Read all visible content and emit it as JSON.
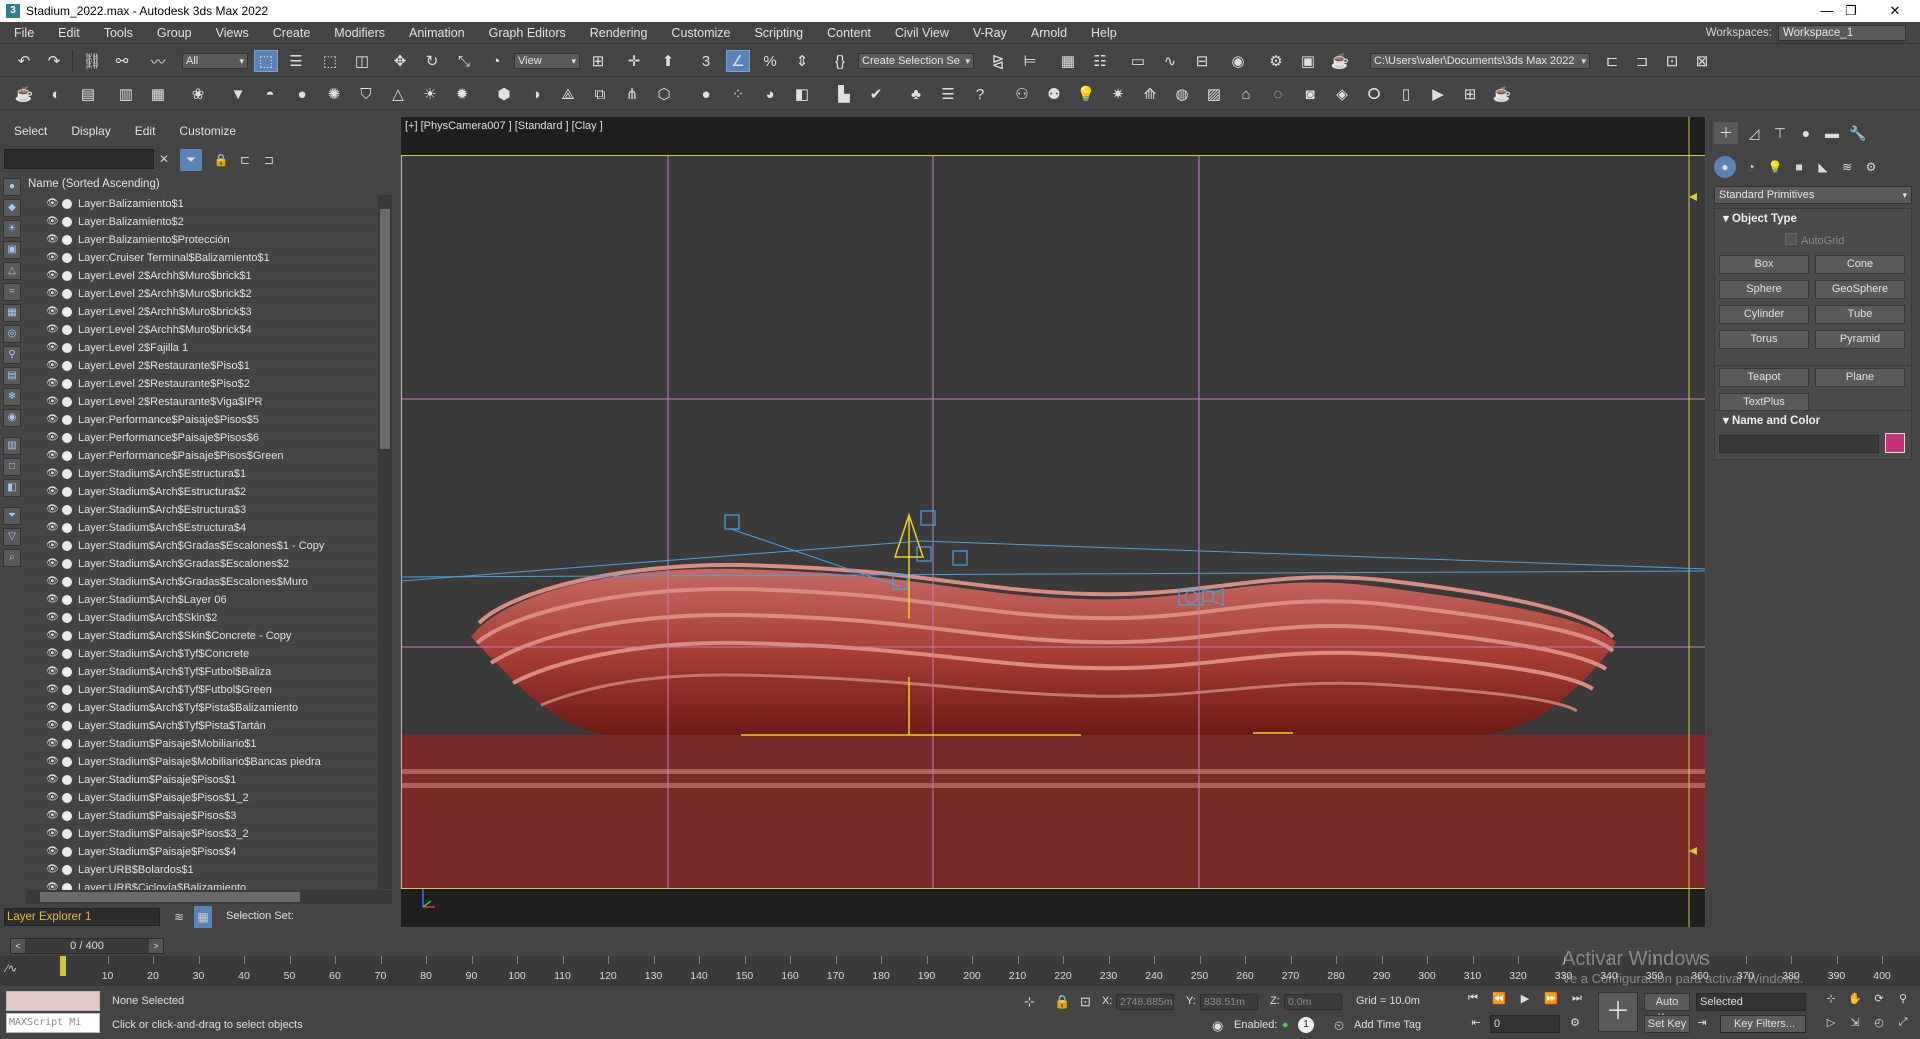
{
  "titlebar": {
    "title": "Stadium_2022.max - Autodesk 3ds Max 2022",
    "minimize": "—",
    "restore": "❐",
    "close": "✕"
  },
  "menu": {
    "items": [
      "File",
      "Edit",
      "Tools",
      "Group",
      "Views",
      "Create",
      "Modifiers",
      "Animation",
      "Graph Editors",
      "Rendering",
      "Customize",
      "Scripting",
      "Content",
      "Civil View",
      "V-Ray",
      "Arnold",
      "Help"
    ],
    "workspaces_label": "Workspaces:",
    "workspace_value": "Workspace_1"
  },
  "toolbar1": {
    "selection_filter": "All",
    "ref_coord": "View",
    "named_selection": "Create Selection Se",
    "project_path": "C:\\Users\\valer\\Documents\\3ds Max 2022"
  },
  "explorer": {
    "menu": [
      "Select",
      "Display",
      "Edit",
      "Customize"
    ],
    "clear": "✕",
    "column_header": "Name (Sorted Ascending)",
    "layers": [
      "Layer:Balizamiento$1",
      "Layer:Balizamiento$2",
      "Layer:Balizamiento$Protección",
      "Layer:Cruiser Terminal$Balizamiento$1",
      "Layer:Level 2$Archh$Muro$brick$1",
      "Layer:Level 2$Archh$Muro$brick$2",
      "Layer:Level 2$Archh$Muro$brick$3",
      "Layer:Level 2$Archh$Muro$brick$4",
      "Layer:Level 2$Fajilla 1",
      "Layer:Level 2$Restaurante$Piso$1",
      "Layer:Level 2$Restaurante$Piso$2",
      "Layer:Level 2$Restaurante$Viga$IPR",
      "Layer:Performance$Paisaje$Pisos$5",
      "Layer:Performance$Paisaje$Pisos$6",
      "Layer:Performance$Paisaje$Pisos$Green",
      "Layer:Stadium$Arch$Estructura$1",
      "Layer:Stadium$Arch$Estructura$2",
      "Layer:Stadium$Arch$Estructura$3",
      "Layer:Stadium$Arch$Estructura$4",
      "Layer:Stadium$Arch$Gradas$Escalones$1 - Copy",
      "Layer:Stadium$Arch$Gradas$Escalones$2",
      "Layer:Stadium$Arch$Gradas$Escalones$Muro",
      "Layer:Stadium$Arch$Layer 06",
      "Layer:Stadium$Arch$Skin$2",
      "Layer:Stadium$Arch$Skin$Concrete - Copy",
      "Layer:Stadium$Arch$Tyf$Concrete",
      "Layer:Stadium$Arch$Tyf$Futbol$Baliza",
      "Layer:Stadium$Arch$Tyf$Futbol$Green",
      "Layer:Stadium$Arch$Tyf$Pista$Balizamiento",
      "Layer:Stadium$Arch$Tyf$Pista$Tartán",
      "Layer:Stadium$Paisaje$Mobiliario$1",
      "Layer:Stadium$Paisaje$Mobiliario$Bancas piedra",
      "Layer:Stadium$Paisaje$Pisos$1",
      "Layer:Stadium$Paisaje$Pisos$1_2",
      "Layer:Stadium$Paisaje$Pisos$3",
      "Layer:Stadium$Paisaje$Pisos$3_2",
      "Layer:Stadium$Paisaje$Pisos$4",
      "Layer:URB$Bolardos$1",
      "Layer:URB$Ciclovía$Balizamiento"
    ],
    "layer_explorer": "Layer Explorer 1",
    "selection_set_label": "Selection Set:"
  },
  "viewport": {
    "label": "[+] [PhysCamera007 ] [Standard ] [Clay ]"
  },
  "command_panel": {
    "category": "Standard Primitives",
    "object_type_header": "Object Type",
    "autogrid": "AutoGrid",
    "primitives": [
      "Box",
      "Cone",
      "Sphere",
      "GeoSphere",
      "Cylinder",
      "Tube",
      "Torus",
      "Pyramid",
      "Teapot",
      "Plane",
      "TextPlus"
    ],
    "name_color_header": "Name and Color",
    "object_color": "#c8327a"
  },
  "timeline": {
    "frame_display": "0 / 400",
    "ticks": [
      10,
      20,
      30,
      40,
      50,
      60,
      70,
      80,
      90,
      100,
      110,
      120,
      130,
      140,
      150,
      160,
      170,
      180,
      190,
      200,
      210,
      220,
      230,
      240,
      250,
      260,
      270,
      280,
      290,
      300,
      310,
      320,
      330,
      340,
      350,
      360,
      370,
      380,
      390,
      400
    ]
  },
  "status": {
    "maxscript_placeholder": "MAXScript Mi",
    "selection_status": "None Selected",
    "prompt": "Click or click-and-drag to select objects",
    "x_label": "X:",
    "x_value": "2748.885m",
    "y_label": "Y:",
    "y_value": "838.51m",
    "z_label": "Z:",
    "z_value": "0.0m",
    "grid": "Grid = 10.0m",
    "enabled_label": "Enabled:",
    "add_time_tag": "Add Time Tag",
    "auto_key": "Auto Key",
    "set_key": "Set Key",
    "key_mode": "Selected",
    "key_filters": "Key Filters...",
    "current_frame": "0",
    "enabled_count": "1"
  },
  "watermark": {
    "line1": "Activar Windows",
    "line2": "Ve a Configuración para activar Windows."
  }
}
